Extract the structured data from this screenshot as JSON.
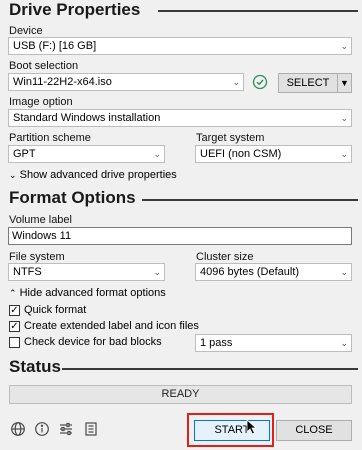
{
  "drive_properties": {
    "title": "Drive Properties",
    "device_label": "Device",
    "device_value": "USB (F:) [16 GB]",
    "boot_selection_label": "Boot selection",
    "boot_selection_value": "Win11-22H2-x64.iso",
    "select_button": "SELECT",
    "image_option_label": "Image option",
    "image_option_value": "Standard Windows installation",
    "partition_scheme_label": "Partition scheme",
    "partition_scheme_value": "GPT",
    "target_system_label": "Target system",
    "target_system_value": "UEFI (non CSM)",
    "advanced_toggle": "Show advanced drive properties"
  },
  "format_options": {
    "title": "Format Options",
    "volume_label_label": "Volume label",
    "volume_label_value": "Windows 11",
    "file_system_label": "File system",
    "file_system_value": "NTFS",
    "cluster_size_label": "Cluster size",
    "cluster_size_value": "4096 bytes (Default)",
    "advanced_toggle": "Hide advanced format options",
    "quick_format_label": "Quick format",
    "quick_format_checked": true,
    "extended_label_label": "Create extended label and icon files",
    "extended_label_checked": true,
    "bad_blocks_label": "Check device for bad blocks",
    "bad_blocks_checked": false,
    "passes_value": "1 pass"
  },
  "status": {
    "title": "Status",
    "progress_text": "READY"
  },
  "footer": {
    "start_button": "START",
    "close_button": "CLOSE"
  },
  "icons": [
    "globe-icon",
    "info-icon",
    "settings-sliders-icon",
    "log-icon",
    "verify-check-icon",
    "dropdown-arrow-icon",
    "mouse-cursor-icon"
  ],
  "colors": {
    "highlight_box": "#e0201b",
    "verify_icon": "#2e8b57"
  }
}
